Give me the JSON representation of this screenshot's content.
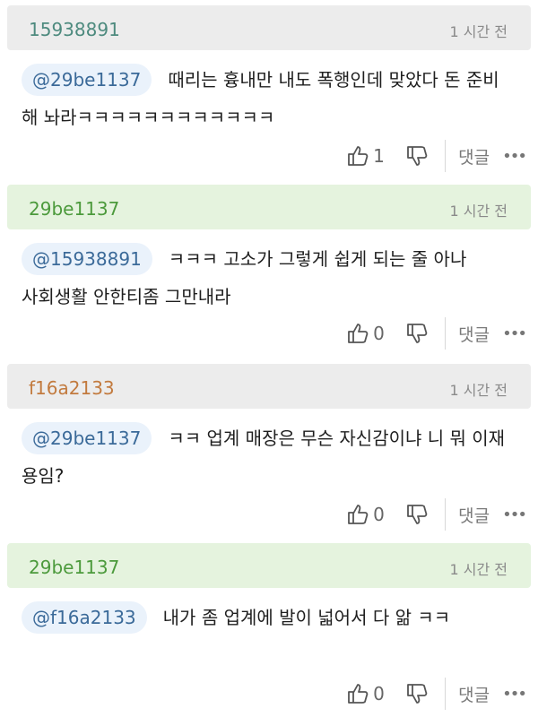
{
  "comments": [
    {
      "user": "15938891",
      "user_color": "#4d8a7e",
      "header_bg": "#ececec",
      "time": "1 시간 전",
      "mention": "@29be1137",
      "text_line1": "때리는 흉내만 내도 폭행인데 맞았다 돈 준비",
      "text_line2": "해 놔라ㅋㅋㅋㅋㅋㅋㅋㅋㅋㅋㅋㅋ",
      "likes": "1",
      "reply_label": "댓글",
      "more": "•••"
    },
    {
      "user": "29be1137",
      "user_color": "#4c9a3c",
      "header_bg": "#e5f3de",
      "time": "1 시간 전",
      "mention": "@15938891",
      "text_line1": "ㅋㅋㅋ 고소가 그렇게 쉽게 되는 줄 아나",
      "text_line2": "사회생활 안한티좀 그만내라",
      "likes": "0",
      "reply_label": "댓글",
      "more": "•••"
    },
    {
      "user": "f16a2133",
      "user_color": "#c27a3e",
      "header_bg": "#ececec",
      "time": "1 시간 전",
      "mention": "@29be1137",
      "text_line1": "ㅋㅋ 업계 매장은 무슨 자신감이냐 니 뭐 이재",
      "text_line2": "용임?",
      "likes": "0",
      "reply_label": "댓글",
      "more": "•••"
    },
    {
      "user": "29be1137",
      "user_color": "#4c9a3c",
      "header_bg": "#e5f3de",
      "time": "1 시간 전",
      "mention": "@f16a2133",
      "text_line1": "내가 좀 업계에 발이 넓어서 다 앎 ㅋㅋ",
      "text_line2": "",
      "likes": "0",
      "reply_label": "댓글",
      "more": "•••"
    }
  ]
}
